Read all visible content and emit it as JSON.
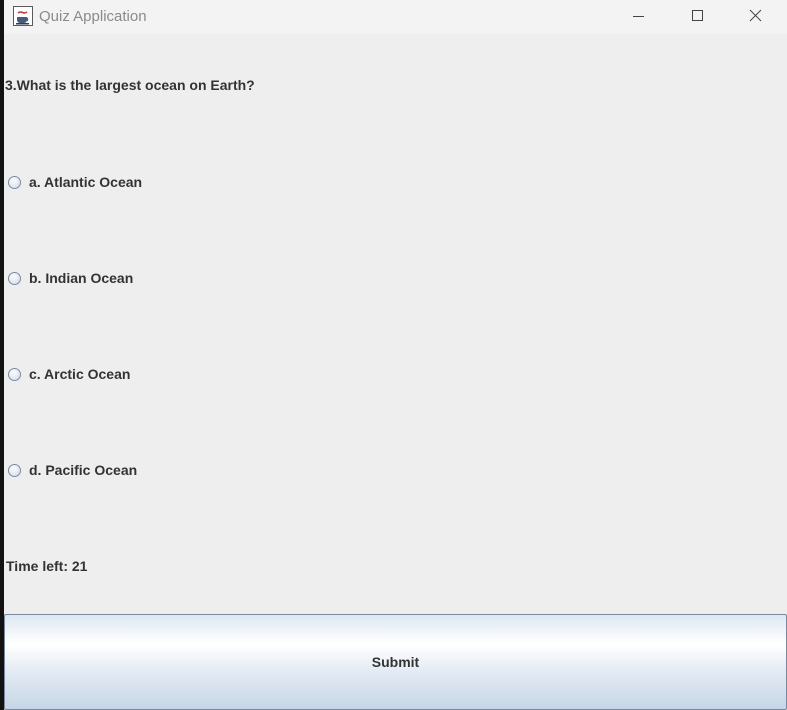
{
  "window": {
    "title": "Quiz Application",
    "icon": "java-cup-icon",
    "controls": [
      "minimize-icon",
      "maximize-icon",
      "close-icon"
    ]
  },
  "quiz": {
    "question": "3.What is the largest ocean on Earth?",
    "options": [
      {
        "label": "a. Atlantic Ocean",
        "selected": false
      },
      {
        "label": "b. Indian Ocean",
        "selected": false
      },
      {
        "label": "c. Arctic Ocean",
        "selected": false
      },
      {
        "label": "d. Pacific Ocean",
        "selected": false
      }
    ],
    "timer_text": "Time left: 21",
    "submit_label": "Submit"
  }
}
